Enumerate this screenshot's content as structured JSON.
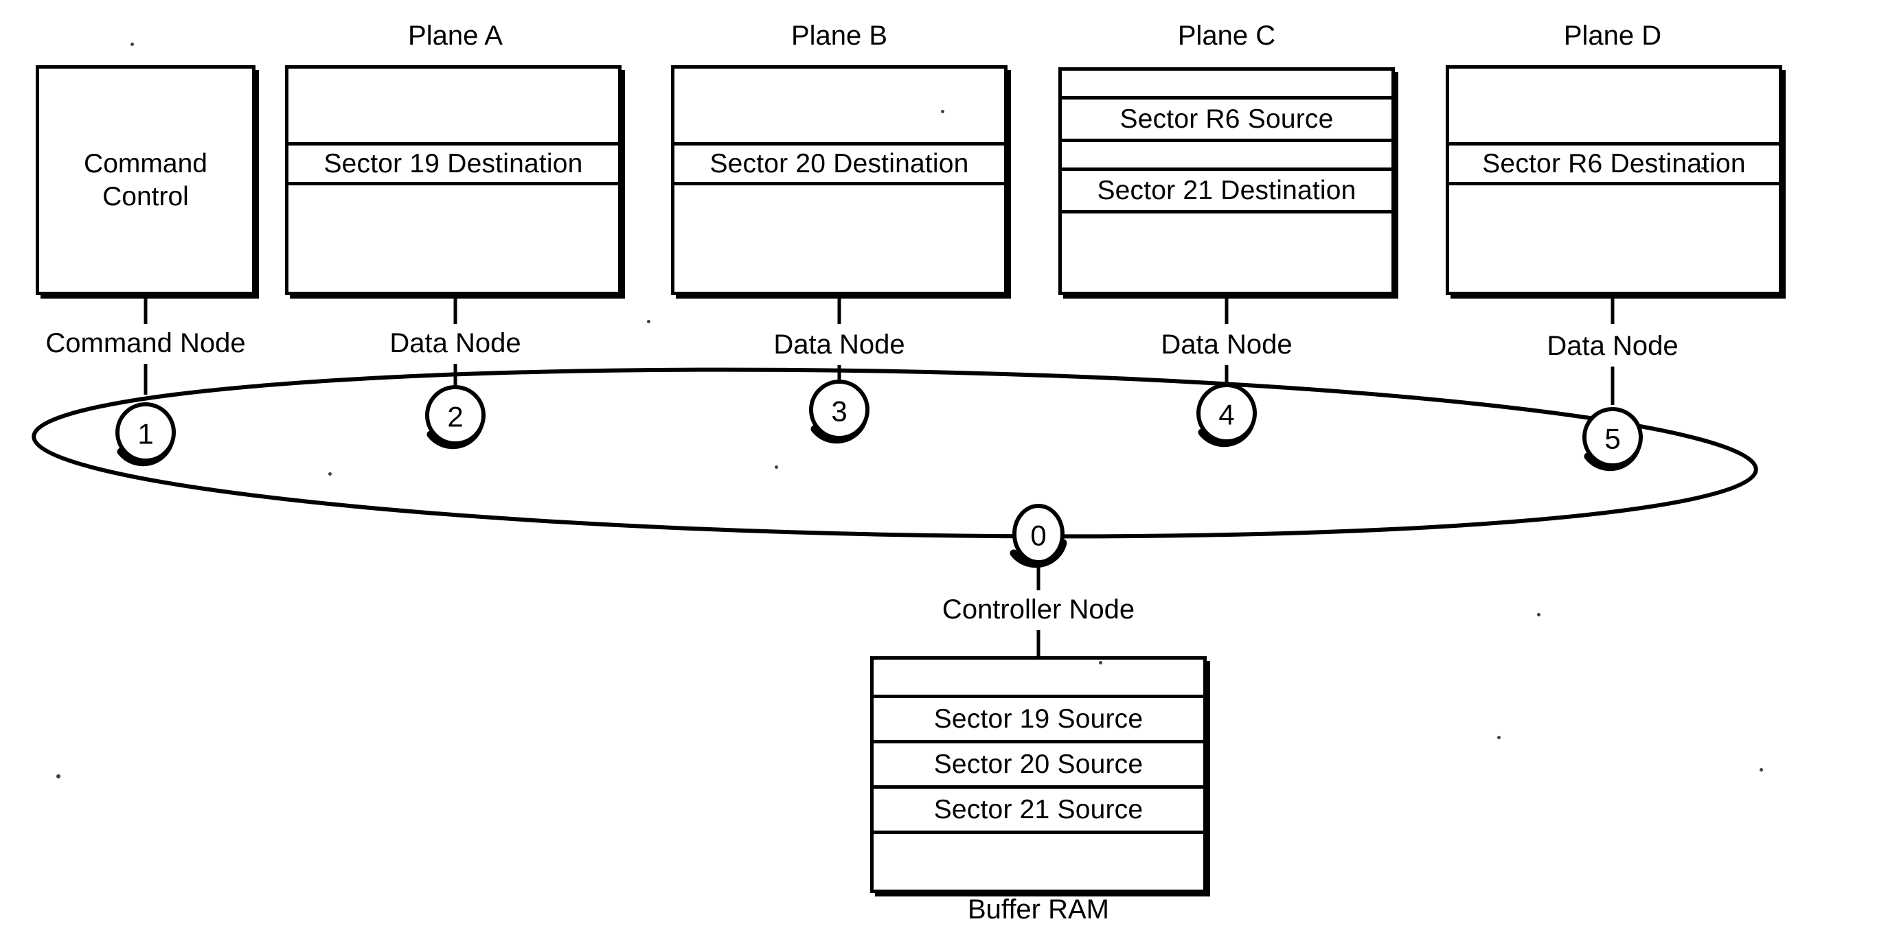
{
  "diagram": {
    "title_blocks": {
      "plane_a": "Plane A",
      "plane_b": "Plane B",
      "plane_c": "Plane C",
      "plane_d": "Plane D"
    },
    "command_control": {
      "label_line1": "Command",
      "label_line2": "Control",
      "node_caption": "Command Node",
      "node_number": "1"
    },
    "planes": [
      {
        "title": "Plane A",
        "node_caption": "Data Node",
        "node_number": "2",
        "rows": [
          {
            "text": "",
            "kind": "blank",
            "height": 112
          },
          {
            "text": "Sector 19 Destination",
            "kind": "text",
            "height": 58
          },
          {
            "text": "",
            "kind": "blank",
            "height": 58
          }
        ]
      },
      {
        "title": "Plane B",
        "node_caption": "Data Node",
        "node_number": "3",
        "rows": [
          {
            "text": "",
            "kind": "blank",
            "height": 112
          },
          {
            "text": "Sector 20 Destination",
            "kind": "text",
            "height": 58
          },
          {
            "text": "",
            "kind": "blank",
            "height": 58
          }
        ]
      },
      {
        "title": "Plane C",
        "node_caption": "Data Node",
        "node_number": "4",
        "rows": [
          {
            "text": "",
            "kind": "blank",
            "height": 42
          },
          {
            "text": "Sector R6 Source",
            "kind": "text",
            "height": 58
          },
          {
            "text": "",
            "kind": "blank",
            "height": 42
          },
          {
            "text": "Sector 21 Destination",
            "kind": "text",
            "height": 58
          },
          {
            "text": "",
            "kind": "blank",
            "height": 48
          }
        ]
      },
      {
        "title": "Plane D",
        "node_caption": "Data Node",
        "node_number": "5",
        "rows": [
          {
            "text": "",
            "kind": "blank",
            "height": 112
          },
          {
            "text": "Sector R6 Destination",
            "kind": "text",
            "height": 58
          },
          {
            "text": "",
            "kind": "blank",
            "height": 58
          }
        ]
      }
    ],
    "controller": {
      "node_number": "0",
      "node_caption": "Controller Node"
    },
    "buffer_ram": {
      "caption": "Buffer RAM",
      "rows": [
        {
          "text": "",
          "kind": "blank",
          "height": 56
        },
        {
          "text": "Sector 19 Source",
          "kind": "text",
          "height": 58
        },
        {
          "text": "Sector 20 Source",
          "kind": "text",
          "height": 58
        },
        {
          "text": "Sector 21 Source",
          "kind": "text",
          "height": 58
        },
        {
          "text": "",
          "kind": "blank",
          "height": 56
        }
      ]
    },
    "ring": {
      "description": "ring network loop",
      "nodes": [
        "1",
        "2",
        "3",
        "4",
        "5",
        "0"
      ]
    },
    "colors": {
      "line": "#000000",
      "background": "#ffffff"
    }
  }
}
